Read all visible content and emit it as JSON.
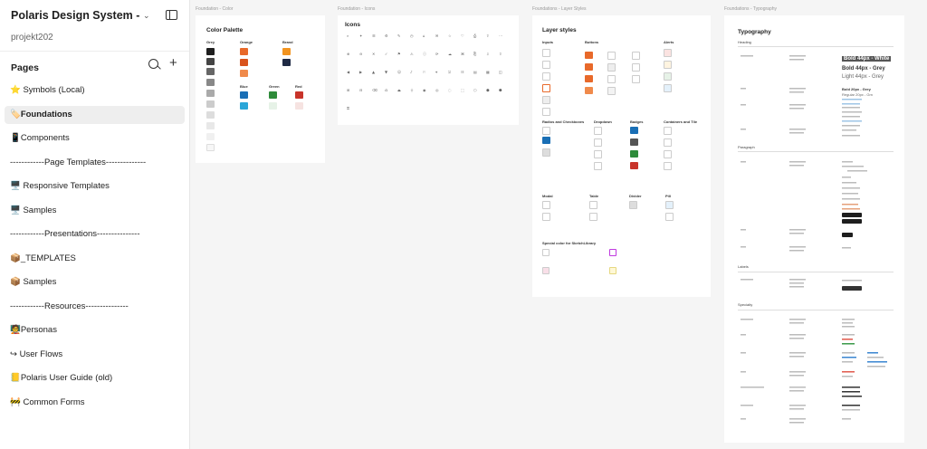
{
  "file": {
    "title": "Polaris Design System - ...",
    "project": "projekt202"
  },
  "pages_header": {
    "label": "Pages"
  },
  "pages": [
    {
      "label": "⭐ Symbols (Local)",
      "active": false
    },
    {
      "label": "🏷️Foundations",
      "active": true
    },
    {
      "label": "📱Components",
      "active": false
    },
    {
      "label": "------------Page Templates--------------",
      "active": false
    },
    {
      "label": "🖥️ Responsive Templates",
      "active": false
    },
    {
      "label": "🖥️ Samples",
      "active": false
    },
    {
      "label": "------------Presentations---------------",
      "active": false
    },
    {
      "label": "📦_TEMPLATES",
      "active": false
    },
    {
      "label": "📦 Samples",
      "active": false
    },
    {
      "label": "------------Resources---------------",
      "active": false
    },
    {
      "label": "🧑‍🏫Personas",
      "active": false
    },
    {
      "label": "↪ User Flows",
      "active": false
    },
    {
      "label": "📒Polaris User Guide (old)",
      "active": false
    },
    {
      "label": "🚧 Common Forms",
      "active": false
    }
  ],
  "frames": {
    "color": {
      "label": "Foundation - Color",
      "title": "Color Palette",
      "groups": {
        "grey": "Grey",
        "orange": "Orange",
        "brand": "Brand",
        "blue": "Blue",
        "green": "Green",
        "red": "Red"
      }
    },
    "icons": {
      "label": "Foundation - Icons",
      "title": "Icons"
    },
    "layer": {
      "label": "Foundations - Layer Styles",
      "title": "Layer styles",
      "sections": {
        "inputs": "Inputs",
        "buttons": "Buttons",
        "alerts": "Alerts",
        "radios": "Radios and Checkboxes",
        "dropdown": "Dropdown",
        "badges": "Badges",
        "containers": "Containers and Tile",
        "modal": "Modal",
        "table": "Table",
        "divider": "Divider",
        "pill": "Pill",
        "special": "Special color for SketchLibrary"
      }
    },
    "typography": {
      "label": "Foundations - Typography",
      "title": "Typography",
      "sections": {
        "heading": "Heading",
        "paragraph": "Paragraph",
        "labels": "Labels",
        "specialty": "Specialty"
      },
      "samples": {
        "white": "Bold 44px - White",
        "grey": "Bold 44px - Grey",
        "light": "Light 44px - Grey",
        "b20": "Bold 20px - Grey",
        "r20": "Regular 20px - Grn"
      }
    }
  },
  "colors": {
    "accent_orange": "#e8692a",
    "brand_navy": "#1f2a44",
    "blue": "#1a6fb5",
    "green": "#2e8b3a",
    "red": "#c8342a",
    "dark": "#1e1e1e"
  }
}
